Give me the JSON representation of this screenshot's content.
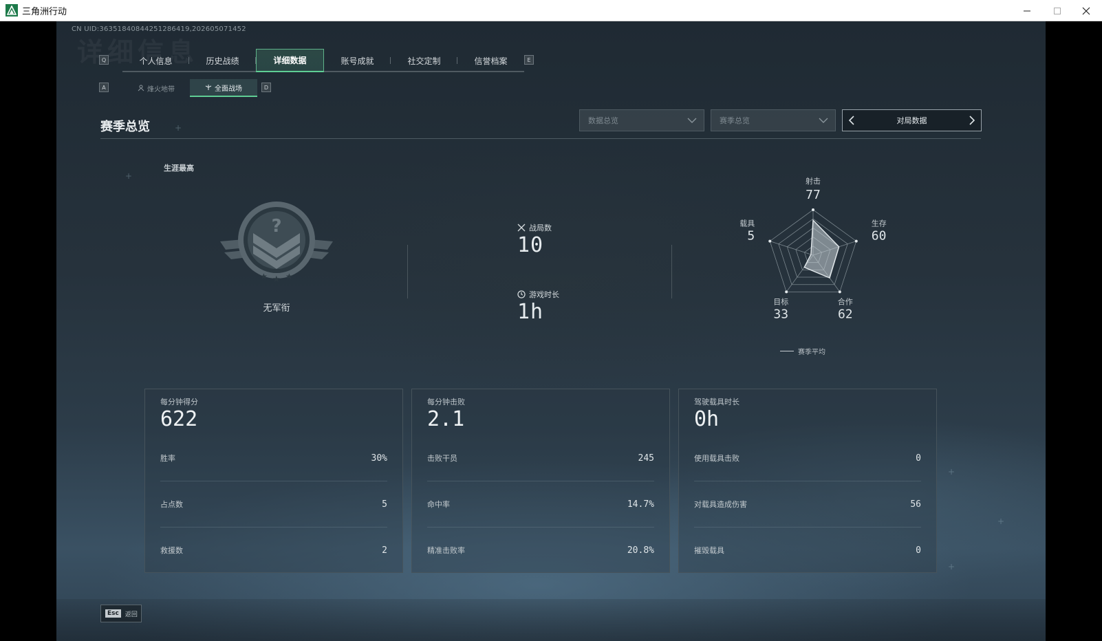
{
  "window": {
    "title": "三角洲行动"
  },
  "uid": "CN UID:36351840844251286419,202605071452",
  "ghost_title": "详细信息",
  "keys": {
    "tab_prev": "Q",
    "tab_next": "E",
    "sub_prev": "A",
    "sub_next": "D"
  },
  "tabs": [
    {
      "label": "个人信息"
    },
    {
      "label": "历史战绩"
    },
    {
      "label": "详细数据"
    },
    {
      "label": "账号成就"
    },
    {
      "label": "社交定制"
    },
    {
      "label": "信誉档案"
    }
  ],
  "subtabs": [
    {
      "label": "烽火地带"
    },
    {
      "label": "全面战场"
    }
  ],
  "section_title": "赛季总览",
  "filters": {
    "data_overview": "数据总览",
    "season_overview": "赛季总览",
    "match_data": "对局数据"
  },
  "career": {
    "label": "生涯最高",
    "rank_name": "无军衔"
  },
  "stats": {
    "matches_label": "战局数",
    "matches_value": "10",
    "playtime_label": "游戏时长",
    "playtime_value": "1h"
  },
  "radar": {
    "axes": [
      {
        "name": "射击",
        "value": "77"
      },
      {
        "name": "生存",
        "value": "60"
      },
      {
        "name": "合作",
        "value": "62"
      },
      {
        "name": "目标",
        "value": "33"
      },
      {
        "name": "载具",
        "value": "5"
      }
    ],
    "legend": "赛季平均"
  },
  "cards": [
    {
      "title": "每分钟得分",
      "big": "622",
      "rows": [
        {
          "label": "胜率",
          "value": "30%"
        },
        {
          "label": "占点数",
          "value": "5"
        },
        {
          "label": "救援数",
          "value": "2"
        }
      ]
    },
    {
      "title": "每分钟击败",
      "big": "2.1",
      "rows": [
        {
          "label": "击败干员",
          "value": "245"
        },
        {
          "label": "命中率",
          "value": "14.7%"
        },
        {
          "label": "精准击败率",
          "value": "20.8%"
        }
      ]
    },
    {
      "title": "驾驶载具时长",
      "big": "0h",
      "rows": [
        {
          "label": "使用载具击败",
          "value": "0"
        },
        {
          "label": "对载具造成伤害",
          "value": "56"
        },
        {
          "label": "摧毁载具",
          "value": "0"
        }
      ]
    }
  ],
  "footer": {
    "esc_key": "Esc",
    "back_label": "返回"
  }
}
